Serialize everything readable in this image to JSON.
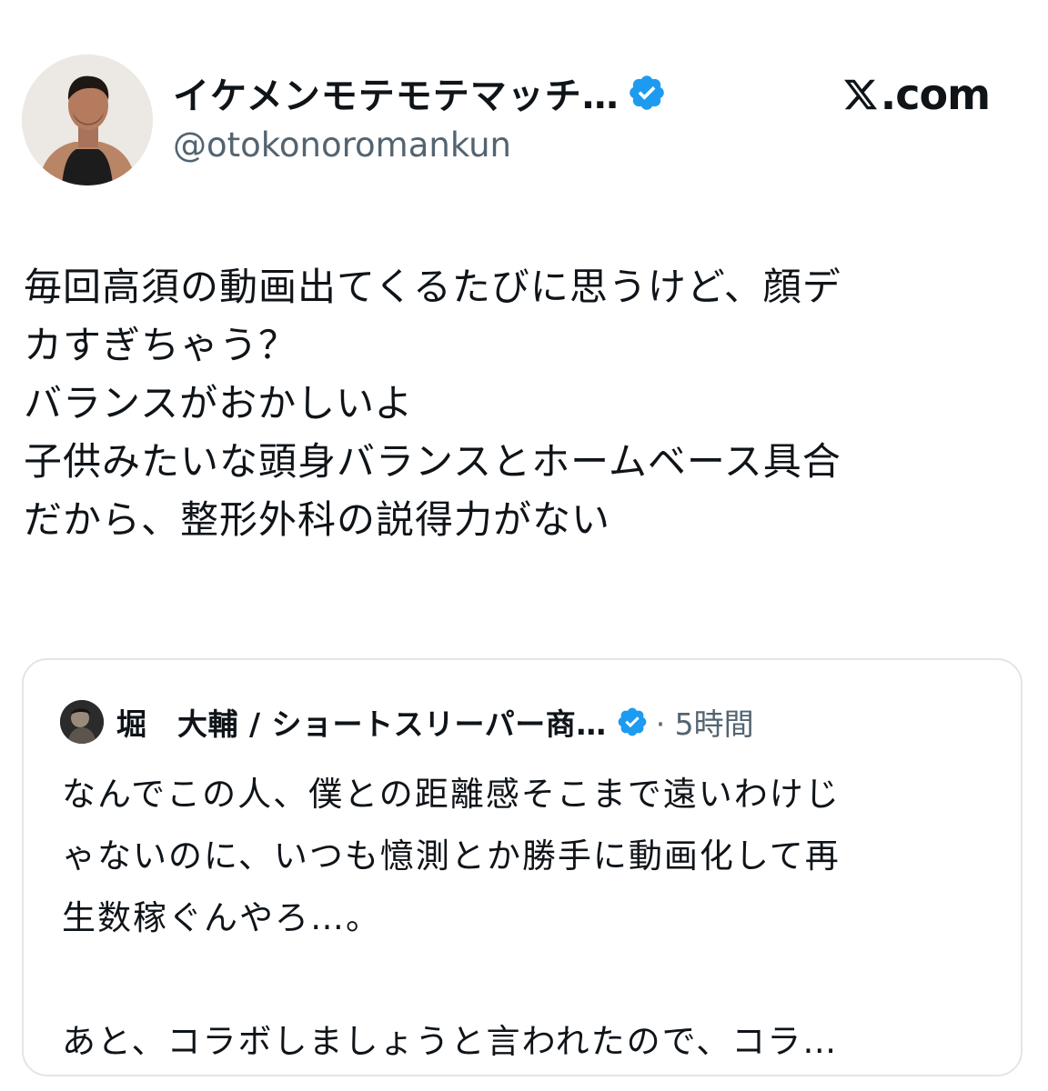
{
  "post": {
    "display_name": "イケメンモテモテマッチ…",
    "handle": "@otokonoromankun",
    "site_label": ".com",
    "icons": {
      "verified": "verified-badge-icon",
      "brand": "x-logo-icon"
    },
    "text_lines": [
      "毎回高須の動画出てくるたびに思うけど、顔デ",
      "カすぎちゃう？",
      "バランスがおかしいよ",
      "子供みたいな頭身バランスとホームベース具合",
      "だから、整形外科の説得力がない"
    ]
  },
  "quoted_post": {
    "display_name": "堀　大輔 / ショートスリーパー商…",
    "time": "· 5時間",
    "text_lines": [
      "なんでこの人、僕との距離感そこまで遠いわけじ",
      "ゃないのに、いつも憶測とか勝手に動画化して再",
      "生数稼ぐんやろ…。"
    ],
    "text_lines_after_gap": [
      "あと、コラボしましょうと言われたので、コラ…"
    ]
  },
  "colors": {
    "text_primary": "#0f1419",
    "text_secondary": "#536471",
    "verified_blue": "#1d9bf0",
    "card_border": "#e1e5e9"
  }
}
